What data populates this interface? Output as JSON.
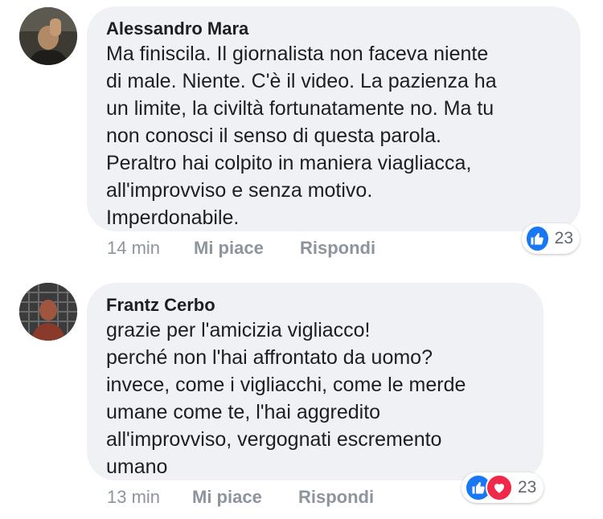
{
  "comments": [
    {
      "author": "Alessandro Mara",
      "text": "Ma finiscila. Il giornalista non faceva niente\ndi male. Niente. C'è il video. La pazienza ha\nun limite, la civiltà fortunatamente no. Ma tu\nnon conosci il senso di questa parola.\nPeraltro hai colpito in maniera viagliacca,\nall'improvviso e senza motivo.\nImperdonabile.",
      "time": "14 min",
      "like_label": "Mi piace",
      "reply_label": "Rispondi",
      "reaction_icons": [
        "like-icon"
      ],
      "reaction_count": "23"
    },
    {
      "author": "Frantz Cerbo",
      "text": "grazie per l'amicizia vigliacco!\nperché non l'hai affrontato da uomo?\ninvece, come i vigliacchi, come le merde\numane come te, l'hai aggredito\nall'improvviso, vergognati escremento\numano",
      "time": "13 min",
      "like_label": "Mi piace",
      "reply_label": "Rispondi",
      "reaction_icons": [
        "like-icon",
        "love-icon"
      ],
      "reaction_count": "23"
    }
  ],
  "colors": {
    "like": "#1877f2",
    "love": "#f0284a",
    "bubble": "#f0f1f4",
    "meta": "#8d949e"
  }
}
